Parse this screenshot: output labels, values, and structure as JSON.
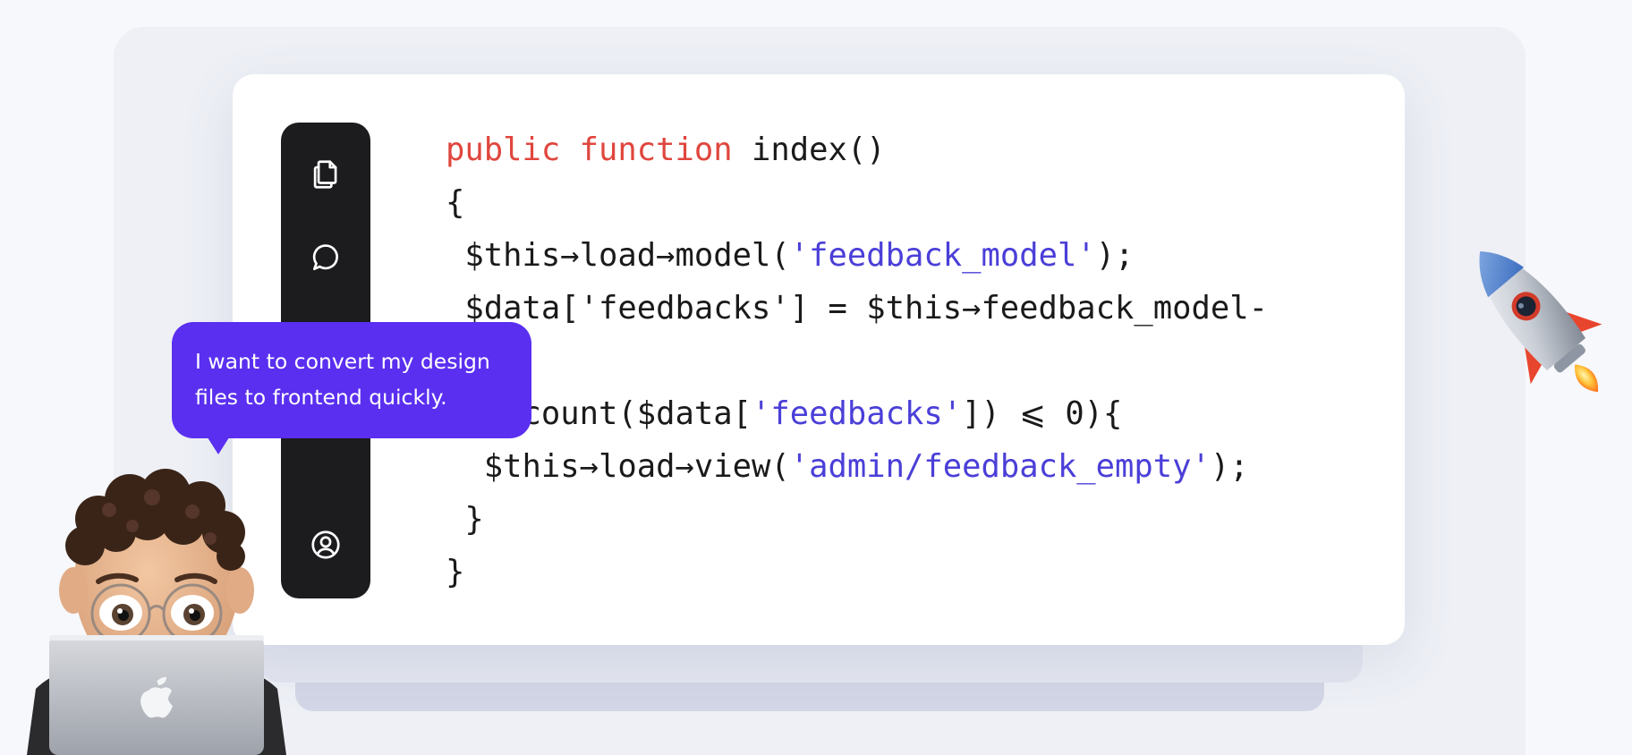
{
  "toolbar": {
    "icons": [
      "copy-icon",
      "comment-icon",
      "user-circle-icon"
    ]
  },
  "code": {
    "line1_kw": "public function",
    "line1_rest": " index()",
    "line2": "{",
    "line3_pre": " $this→load→model(",
    "line3_str": "'feedback_model'",
    "line3_post": ");",
    "line4": " $data['feedbacks'] = $this→feedback_model-",
    "line5": " ();",
    "line6_pre": " if(count($data[",
    "line6_str": "'feedbacks'",
    "line6_post": "]) ⩽ 0){",
    "line7_pre": "  $this→load→view(",
    "line7_str": "'admin/feedback_empty'",
    "line7_post": ");",
    "line8": " }",
    "line9": "}"
  },
  "bubble": {
    "line1": "I want to convert my design",
    "line2": "files to frontend quickly."
  },
  "colors": {
    "keyword": "#e0463d",
    "string": "#4b3fd8",
    "bubble": "#5a2ff0",
    "toolbar": "#1c1c1e"
  },
  "illustrations": [
    "rocket",
    "developer-avatar-with-laptop"
  ]
}
